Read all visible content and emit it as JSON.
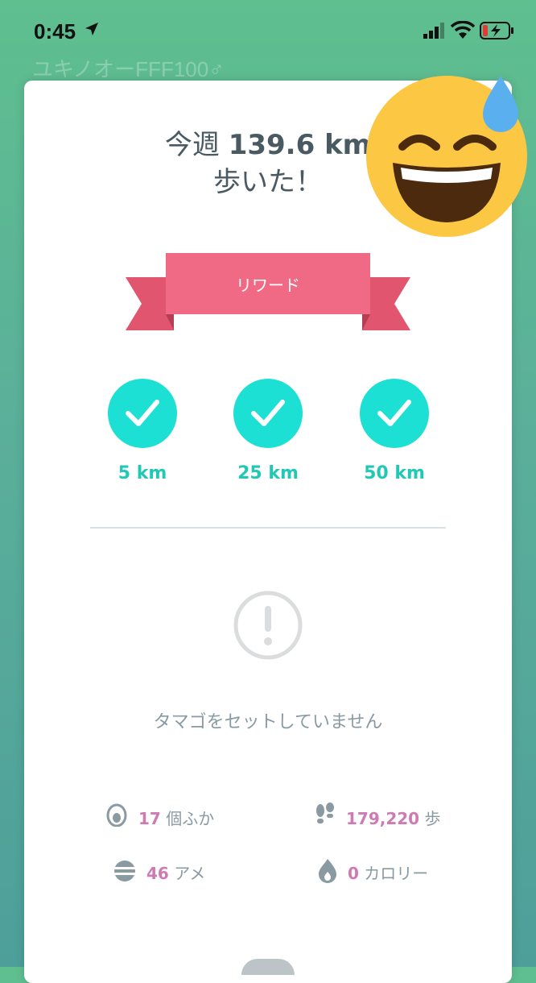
{
  "status_bar": {
    "time": "0:45"
  },
  "background": {
    "trainer_name": "ユキノオーFFF100♂"
  },
  "card": {
    "title_prefix": "今週",
    "distance": "139.6 km",
    "title_line2": "歩いた！",
    "ribbon_label": "リワード",
    "milestones": [
      {
        "label": "5 km",
        "achieved": true
      },
      {
        "label": "25 km",
        "achieved": true
      },
      {
        "label": "50 km",
        "achieved": true
      }
    ],
    "no_egg_message": "タマゴをセットしていません",
    "stats": {
      "hatched": {
        "value": "17",
        "unit": "個ふか"
      },
      "steps": {
        "value": "179,220",
        "unit": "歩"
      },
      "candy": {
        "value": "46",
        "unit": "アメ"
      },
      "calories": {
        "value": "0",
        "unit": "カロリー"
      }
    }
  },
  "colors": {
    "ribbon": "#f06a86",
    "badge": "#1de0d4",
    "stat_number": "#d07ab3"
  }
}
